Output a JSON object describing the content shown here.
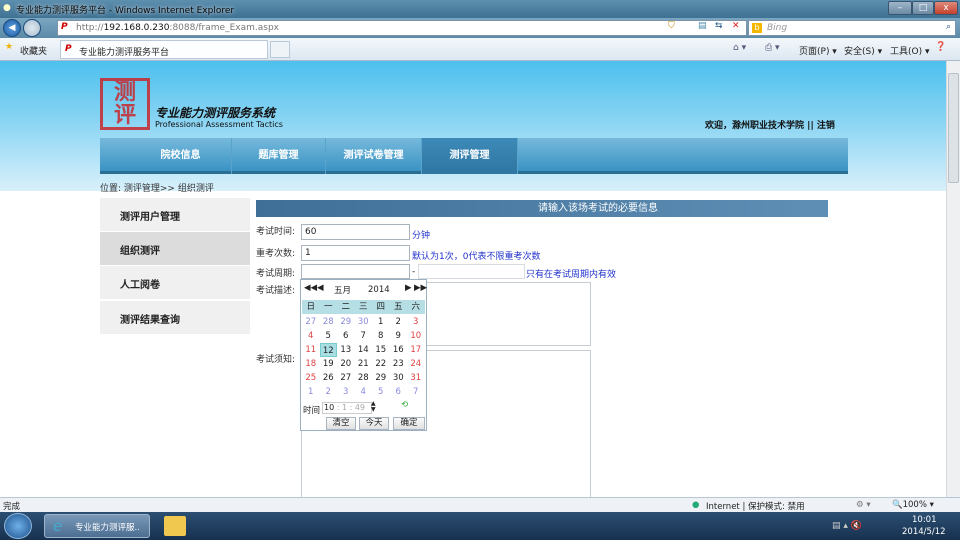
{
  "browser": {
    "title": "专业能力测评服务平台 - Windows Internet Explorer",
    "url_prefix": "http://",
    "url_host": "192.168.0.230",
    "url_rest": ":8088/frame_Exam.aspx",
    "search_placeholder": "Bing",
    "favorites": "收藏夹",
    "tab": "专业能力测评服务平台",
    "menu": [
      "页面(P) ▾",
      "安全(S) ▾",
      "工具(O) ▾"
    ]
  },
  "header": {
    "system_name": "专业能力测评服务系统",
    "system_name_en": "Professional Assessment Tactics",
    "welcome": "欢迎，滁州职业技术学院",
    "separator": "||",
    "logout": "注销"
  },
  "nav": [
    {
      "label": "院校信息"
    },
    {
      "label": "题库管理"
    },
    {
      "label": "测评试卷管理"
    },
    {
      "label": "测评管理",
      "active": true
    }
  ],
  "breadcrumb": "位置: 测评管理>> 组织测评",
  "sidebar": [
    {
      "label": "测评用户管理"
    },
    {
      "label": "组织测评",
      "active": true
    },
    {
      "label": "人工阅卷"
    },
    {
      "label": "测评结果查询"
    }
  ],
  "form": {
    "title": "请输入该场考试的必要信息",
    "duration_label": "考试时间:",
    "duration_value": "60",
    "duration_unit": "分钟",
    "retake_label": "重考次数:",
    "retake_value": "1",
    "retake_hint": "默认为1次，0代表不限重考次数",
    "period_label": "考试周期:",
    "period_sep": "-",
    "period_hint": "只有在考试周期内有效",
    "desc_label": "考试描述:",
    "notice_label": "考试须知:"
  },
  "calendar": {
    "month": "五月",
    "year": "2014",
    "weekdays": [
      "日",
      "一",
      "二",
      "三",
      "四",
      "五",
      "六"
    ],
    "days": [
      [
        27,
        28,
        29,
        30,
        1,
        2,
        3
      ],
      [
        4,
        5,
        6,
        7,
        8,
        9,
        10
      ],
      [
        11,
        12,
        13,
        14,
        15,
        16,
        17
      ],
      [
        18,
        19,
        20,
        21,
        22,
        23,
        24
      ],
      [
        25,
        26,
        27,
        28,
        29,
        30,
        31
      ],
      [
        1,
        2,
        3,
        4,
        5,
        6,
        7
      ]
    ],
    "selected": 12,
    "time_label": "时间",
    "hour": "10",
    "minute": "1",
    "second": "49",
    "clear": "清空",
    "today": "今天",
    "ok": "确定",
    "colors": {
      "other_month": "#8a8ae0",
      "weekend": "#e04040",
      "selected_bg": "#a8dde3"
    }
  },
  "status": {
    "text": "完成",
    "zone": "Internet | 保护模式: 禁用",
    "zoom": "100%"
  },
  "taskbar": {
    "task": "专业能力测评服..",
    "time": "10:01",
    "date": "2014/5/12"
  }
}
